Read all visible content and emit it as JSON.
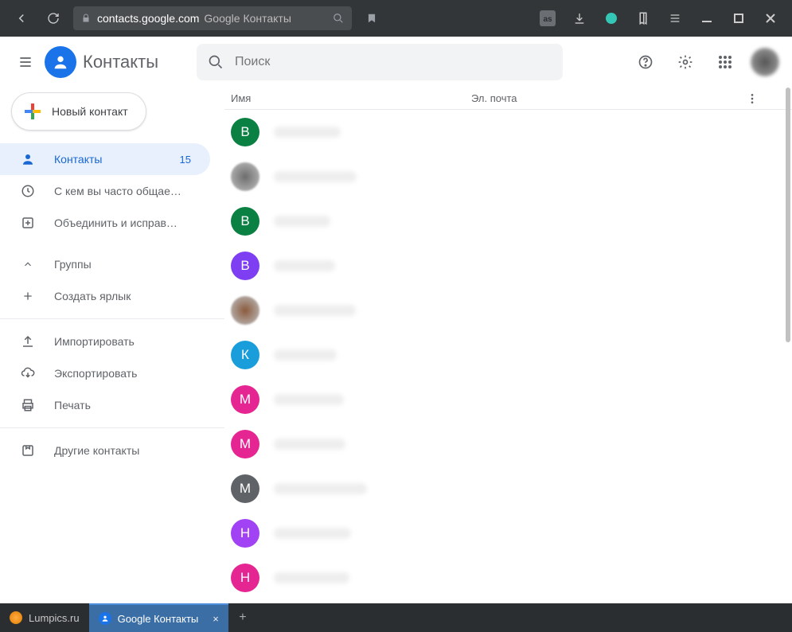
{
  "browser": {
    "host": "contacts.google.com",
    "page_title": "Google Контакты",
    "tabs": [
      {
        "label": "Lumpics.ru",
        "active": false
      },
      {
        "label": "Google Контакты",
        "active": true
      }
    ]
  },
  "header": {
    "app_name": "Контакты",
    "search_placeholder": "Поиск"
  },
  "sidebar": {
    "new_contact": "Новый контакт",
    "items": [
      {
        "icon": "person",
        "label": "Контакты",
        "count": "15",
        "active": true
      },
      {
        "icon": "history",
        "label": "С кем вы часто общае…"
      },
      {
        "icon": "merge",
        "label": "Объединить и исправ…"
      }
    ],
    "groups_label": "Группы",
    "create_label": "Создать ярлык",
    "io": [
      {
        "icon": "upload",
        "label": "Импортировать"
      },
      {
        "icon": "download",
        "label": "Экспортировать"
      },
      {
        "icon": "print",
        "label": "Печать"
      }
    ],
    "other_label": "Другие контакты"
  },
  "columns": {
    "name": "Имя",
    "email": "Эл. почта"
  },
  "contacts": [
    {
      "letter": "В",
      "color": "#0b8043"
    },
    {
      "letter": "",
      "color": "#6d6d6d",
      "img": true
    },
    {
      "letter": "В",
      "color": "#0b8043"
    },
    {
      "letter": "В",
      "color": "#7e3ff2"
    },
    {
      "letter": "",
      "color": "#8b5a3c",
      "img": true
    },
    {
      "letter": "К",
      "color": "#1a9edb"
    },
    {
      "letter": "М",
      "color": "#e52592"
    },
    {
      "letter": "М",
      "color": "#e52592"
    },
    {
      "letter": "М",
      "color": "#5f6368"
    },
    {
      "letter": "Н",
      "color": "#a142f4"
    },
    {
      "letter": "Н",
      "color": "#e52592"
    }
  ]
}
